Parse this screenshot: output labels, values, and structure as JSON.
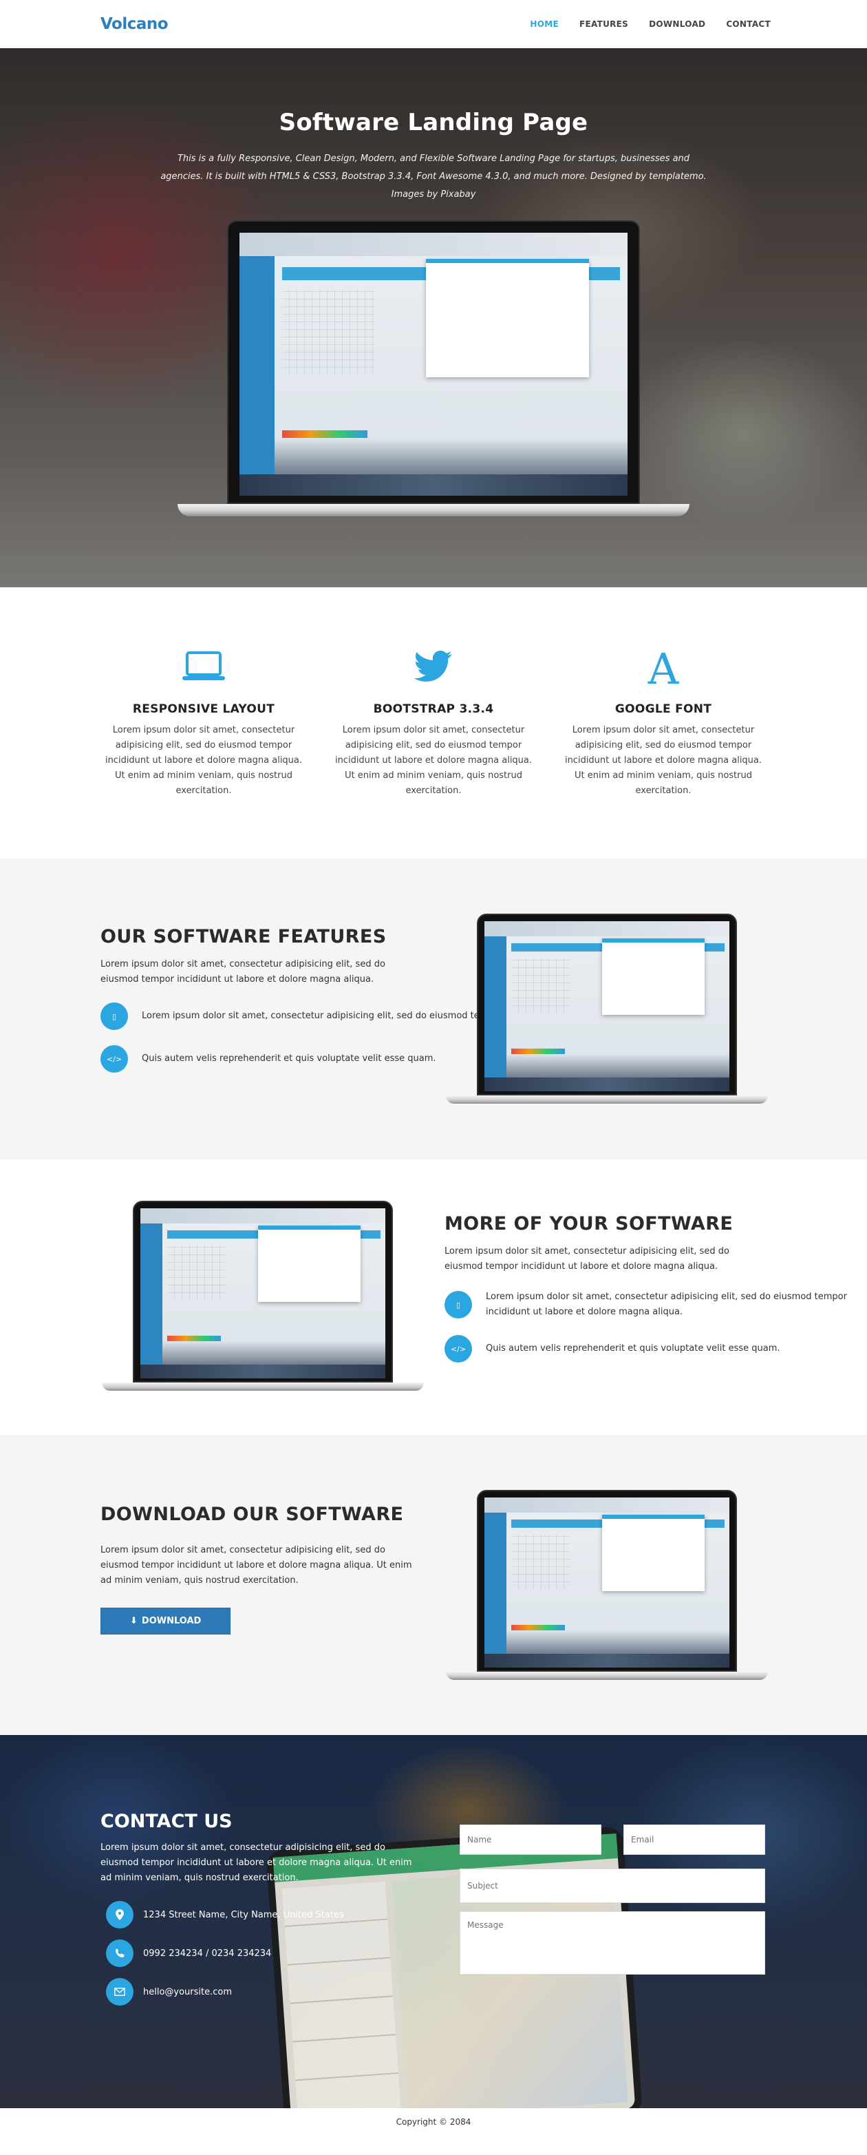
{
  "nav": {
    "logo": "Volcano",
    "items": [
      {
        "label": "HOME",
        "active": true
      },
      {
        "label": "FEATURES",
        "active": false
      },
      {
        "label": "DOWNLOAD",
        "active": false
      },
      {
        "label": "CONTACT",
        "active": false
      }
    ]
  },
  "hero": {
    "title": "Software Landing Page",
    "subtitle": "This is a fully Responsive, Clean Design, Modern, and Flexible Software Landing Page for startups, businesses and agencies. It is built with HTML5 & CSS3, Bootstrap 3.3.4, Font Awesome 4.3.0, and much more. Designed by templatemo. Images by Pixabay"
  },
  "features": [
    {
      "icon": "laptop-icon",
      "title": "RESPONSIVE LAYOUT",
      "text": "Lorem ipsum dolor sit amet, consectetur adipisicing elit, sed do eiusmod tempor incididunt ut labore et dolore magna aliqua. Ut enim ad minim veniam, quis nostrud exercitation."
    },
    {
      "icon": "twitter-icon",
      "title": "BOOTSTRAP 3.3.4",
      "text": "Lorem ipsum dolor sit amet, consectetur adipisicing elit, sed do eiusmod tempor incididunt ut labore et dolore magna aliqua. Ut enim ad minim veniam, quis nostrud exercitation."
    },
    {
      "icon": "font-icon",
      "title": "GOOGLE FONT",
      "text": "Lorem ipsum dolor sit amet, consectetur adipisicing elit, sed do eiusmod tempor incididunt ut labore et dolore magna aliqua. Ut enim ad minim veniam, quis nostrud exercitation."
    }
  ],
  "software_features": {
    "title": "OUR SOFTWARE FEATURES",
    "lead": "Lorem ipsum dolor sit amet, consectetur adipisicing elit, sed do eiusmod tempor incididunt ut labore et dolore magna aliqua.",
    "points": [
      {
        "icon": "mobile-icon",
        "text": "Lorem ipsum dolor sit amet, consectetur adipisicing elit, sed do eiusmod tempor incididunt ut labore et dolore magna aliqua."
      },
      {
        "icon": "code-icon",
        "text": "Quis autem velis reprehenderit et quis voluptate velit esse quam."
      }
    ]
  },
  "more_software": {
    "title": "MORE OF YOUR SOFTWARE",
    "lead": "Lorem ipsum dolor sit amet, consectetur adipisicing elit, sed do eiusmod tempor incididunt ut labore et dolore magna aliqua.",
    "points": [
      {
        "icon": "mobile-icon",
        "text": "Lorem ipsum dolor sit amet, consectetur adipisicing elit, sed do eiusmod tempor incididunt ut labore et dolore magna aliqua."
      },
      {
        "icon": "code-icon",
        "text": "Quis autem velis reprehenderit et quis voluptate velit esse quam."
      }
    ]
  },
  "download": {
    "title": "DOWNLOAD OUR SOFTWARE",
    "lead": "Lorem ipsum dolor sit amet, consectetur adipisicing elit, sed do eiusmod tempor incididunt ut labore et dolore magna aliqua. Ut enim ad minim veniam, quis nostrud exercitation.",
    "button_label": "DOWNLOAD"
  },
  "contact": {
    "title": "CONTACT US",
    "lead": "Lorem ipsum dolor sit amet, consectetur adipisicing elit, sed do eiusmod tempor incididunt ut labore et dolore magna aliqua. Ut enim ad minim veniam, quis nostrud exercitation.",
    "address": "1234 Street Name, City Name, United States",
    "phone": "0992 234234 / 0234 234234",
    "email": "hello@yoursite.com",
    "form": {
      "name_placeholder": "Name",
      "email_placeholder": "Email",
      "subject_placeholder": "Subject",
      "message_placeholder": "Message"
    }
  },
  "footer": {
    "copyright": "Copyright © 2084"
  },
  "colors": {
    "accent": "#2ca6e0",
    "logo": "#2a7fc1",
    "button": "#2e7ab8",
    "section_gray": "#f5f5f5"
  }
}
